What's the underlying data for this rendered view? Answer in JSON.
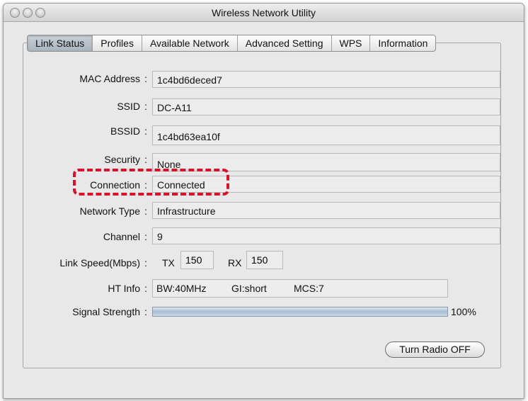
{
  "window": {
    "title": "Wireless Network Utility"
  },
  "tabs": [
    {
      "label": "Link Status",
      "active": true
    },
    {
      "label": "Profiles",
      "active": false
    },
    {
      "label": "Available Network",
      "active": false
    },
    {
      "label": "Advanced Setting",
      "active": false
    },
    {
      "label": "WPS",
      "active": false
    },
    {
      "label": "Information",
      "active": false
    }
  ],
  "link_status": {
    "mac_address": {
      "label": "MAC Address",
      "value": "1c4bd6deced7"
    },
    "ssid": {
      "label": "SSID",
      "value": "DC-A11"
    },
    "bssid": {
      "label": "BSSID",
      "value": "1c4bd63ea10f"
    },
    "security": {
      "label": "Security",
      "value": "None"
    },
    "connection": {
      "label": "Connection",
      "value": "Connected"
    },
    "network_type": {
      "label": "Network Type",
      "value": "Infrastructure"
    },
    "channel": {
      "label": "Channel",
      "value": "9"
    },
    "link_speed": {
      "label": "Link Speed(Mbps)",
      "tx_label": "TX",
      "tx_value": "150",
      "rx_label": "RX",
      "rx_value": "150"
    },
    "ht_info": {
      "label": "HT Info",
      "bw": "BW:40MHz",
      "gi": "GI:short",
      "mcs": "MCS:7"
    },
    "signal_strength": {
      "label": "Signal Strength",
      "percent_text": "100%",
      "level": 1.0
    }
  },
  "colon": ":",
  "buttons": {
    "turn_radio_off": "Turn Radio OFF"
  },
  "colors": {
    "annotation_border": "#d8122a"
  }
}
